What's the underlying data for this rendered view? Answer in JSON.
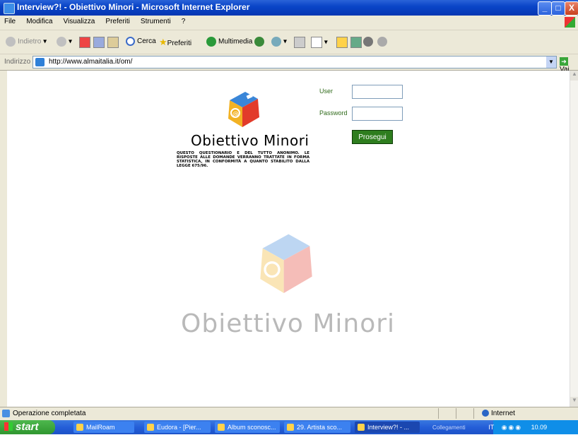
{
  "window": {
    "title": "Interview?! - Obiettivo Minori - Microsoft Internet Explorer",
    "minimize": "_",
    "maximize": "□",
    "close": "X"
  },
  "menu": [
    "File",
    "Modifica",
    "Visualizza",
    "Preferiti",
    "Strumenti",
    "?"
  ],
  "toolbar": {
    "back": "Indietro",
    "search": "Cerca",
    "favorites": "Preferiti",
    "multimedia": "Multimedia"
  },
  "address": {
    "label": "Indirizzo",
    "url": "http://www.almaitalia.it/om/",
    "go": "Vai"
  },
  "page": {
    "logo_title": "Obiettivo Minori",
    "disclaimer": "QUESTO QUESTIONARIO E DEL TUTTO ANONIMO. LE RISPOSTE ALLE DOMANDE VERRANNO TRATTATE IN FORMA STATISTICA, IN CONFORMITÀ A QUANTO STABILITO DALLA LEGGE 675/96.",
    "user_label": "User",
    "password_label": "Password",
    "user_value": "",
    "password_value": "",
    "submit": "Prosegui",
    "watermark_title": "Obiettivo Minori"
  },
  "status": {
    "text": "Operazione completata",
    "zone": "Internet"
  },
  "taskbar": {
    "start": "start",
    "tasks": [
      "MailRoam",
      "Eudora - [Pier...",
      "Album sconosc...",
      "29. Artista sco...",
      "Interview?! - ..."
    ],
    "tray": {
      "collegamenti": "Collegamenti",
      "lang": "IT",
      "clock": "10.09"
    }
  },
  "colors": {
    "title_blue": "#0a45c8",
    "button_green": "#2e7d1e",
    "label_green": "#2f6a1a",
    "taskbar_blue": "#245ed8",
    "start_green": "#3a9e3a"
  }
}
